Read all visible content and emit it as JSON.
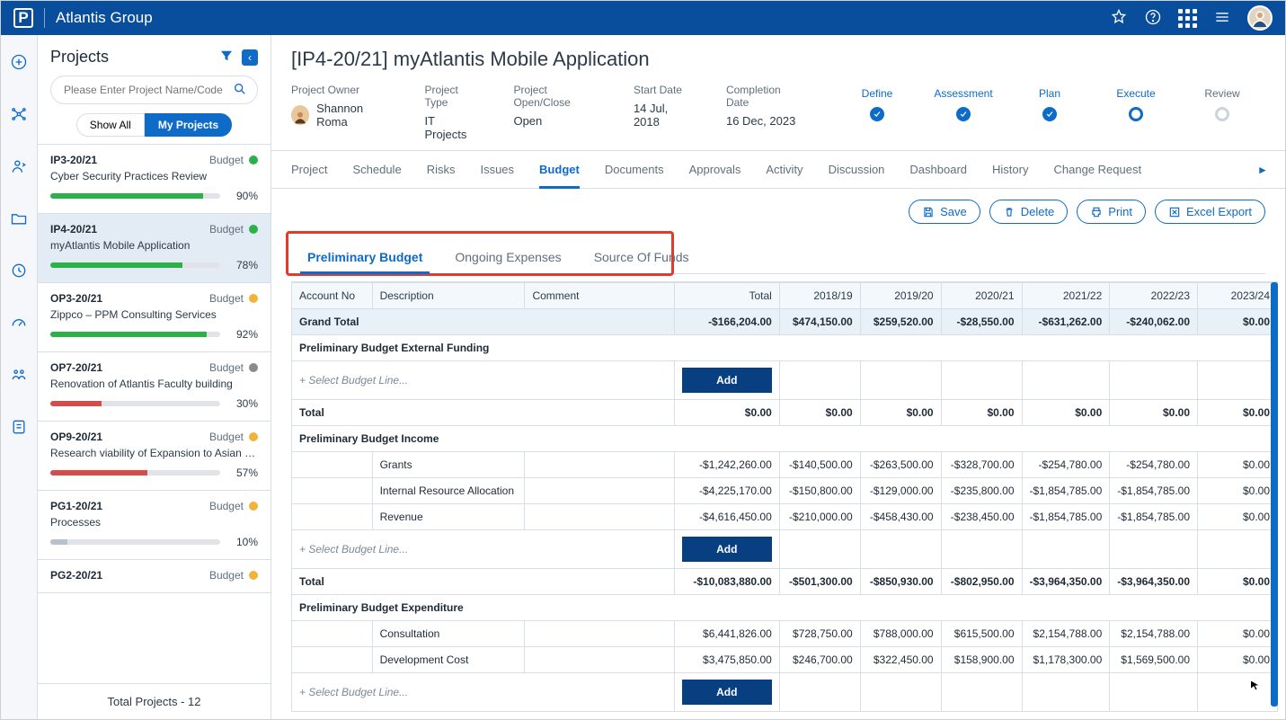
{
  "header": {
    "org_name": "Atlantis Group",
    "logo_letter": "P"
  },
  "projects_panel": {
    "title": "Projects",
    "search_placeholder": "Please Enter Project Name/Code",
    "toggle_all": "Show All",
    "toggle_mine": "My Projects",
    "footer": "Total Projects - 12",
    "budget_label": "Budget",
    "items": [
      {
        "code": "IP3-20/21",
        "name": "Cyber Security Practices Review",
        "pct": "90%",
        "pct_n": 90,
        "dot": "green",
        "bar": "green",
        "active": false
      },
      {
        "code": "IP4-20/21",
        "name": "myAtlantis Mobile Application",
        "pct": "78%",
        "pct_n": 78,
        "dot": "green",
        "bar": "green",
        "active": true
      },
      {
        "code": "OP3-20/21",
        "name": "Zippco – PPM Consulting Services",
        "pct": "92%",
        "pct_n": 92,
        "dot": "amber",
        "bar": "green",
        "active": false
      },
      {
        "code": "OP7-20/21",
        "name": "Renovation of Atlantis Faculty building",
        "pct": "30%",
        "pct_n": 30,
        "dot": "gray",
        "bar": "red",
        "active": false
      },
      {
        "code": "OP9-20/21",
        "name": "Research viability of Expansion to Asian M...",
        "pct": "57%",
        "pct_n": 57,
        "dot": "amber",
        "bar": "red",
        "active": false
      },
      {
        "code": "PG1-20/21",
        "name": "Processes",
        "pct": "10%",
        "pct_n": 10,
        "dot": "amber",
        "bar": "gray",
        "active": false
      },
      {
        "code": "PG2-20/21",
        "name": "",
        "pct": "",
        "pct_n": 0,
        "dot": "amber",
        "bar": "none",
        "active": false
      }
    ]
  },
  "project": {
    "title": "[IP4-20/21] myAtlantis Mobile Application",
    "meta": {
      "owner_label": "Project Owner",
      "owner_value": "Shannon Roma",
      "type_label": "Project Type",
      "type_value": "IT Projects",
      "open_label": "Project Open/Close",
      "open_value": "Open",
      "start_label": "Start Date",
      "start_value": "14 Jul, 2018",
      "complete_label": "Completion Date",
      "complete_value": "16 Dec, 2023"
    },
    "stages": [
      "Define",
      "Assessment",
      "Plan",
      "Execute",
      "Review"
    ]
  },
  "tabs": [
    "Project",
    "Schedule",
    "Risks",
    "Issues",
    "Budget",
    "Documents",
    "Approvals",
    "Activity",
    "Discussion",
    "Dashboard",
    "History",
    "Change Request"
  ],
  "tabs_active": "Budget",
  "actions": {
    "save": "Save",
    "delete": "Delete",
    "print": "Print",
    "export": "Excel Export"
  },
  "subtabs": {
    "active": "Preliminary Budget",
    "items": [
      "Preliminary Budget",
      "Ongoing Expenses",
      "Source Of Funds"
    ]
  },
  "grid": {
    "cols": [
      "Account No",
      "Description",
      "Comment",
      "Total",
      "2018/19",
      "2019/20",
      "2020/21",
      "2021/22",
      "2022/23",
      "2023/24"
    ],
    "grand_label": "Grand Total",
    "grand": [
      "-$166,204.00",
      "$474,150.00",
      "$259,520.00",
      "-$28,550.00",
      "-$631,262.00",
      "-$240,062.00",
      "$0.00"
    ],
    "select_label": "+ Select Budget Line...",
    "add_label": "Add",
    "groups": [
      {
        "title": "Preliminary Budget External Funding",
        "rows": [],
        "total_label": "Total",
        "total": [
          "$0.00",
          "$0.00",
          "$0.00",
          "$0.00",
          "$0.00",
          "$0.00",
          "$0.00"
        ]
      },
      {
        "title": "Preliminary Budget Income",
        "rows": [
          {
            "desc": "Grants",
            "vals": [
              "-$1,242,260.00",
              "-$140,500.00",
              "-$263,500.00",
              "-$328,700.00",
              "-$254,780.00",
              "-$254,780.00",
              "$0.00"
            ]
          },
          {
            "desc": "Internal Resource Allocation",
            "vals": [
              "-$4,225,170.00",
              "-$150,800.00",
              "-$129,000.00",
              "-$235,800.00",
              "-$1,854,785.00",
              "-$1,854,785.00",
              "$0.00"
            ]
          },
          {
            "desc": "Revenue",
            "vals": [
              "-$4,616,450.00",
              "-$210,000.00",
              "-$458,430.00",
              "-$238,450.00",
              "-$1,854,785.00",
              "-$1,854,785.00",
              "$0.00"
            ]
          }
        ],
        "total_label": "Total",
        "total": [
          "-$10,083,880.00",
          "-$501,300.00",
          "-$850,930.00",
          "-$802,950.00",
          "-$3,964,350.00",
          "-$3,964,350.00",
          "$0.00"
        ]
      },
      {
        "title": "Preliminary Budget Expenditure",
        "rows": [
          {
            "desc": "Consultation",
            "vals": [
              "$6,441,826.00",
              "$728,750.00",
              "$788,000.00",
              "$615,500.00",
              "$2,154,788.00",
              "$2,154,788.00",
              "$0.00"
            ]
          },
          {
            "desc": "Development Cost",
            "vals": [
              "$3,475,850.00",
              "$246,700.00",
              "$322,450.00",
              "$158,900.00",
              "$1,178,300.00",
              "$1,569,500.00",
              "$0.00"
            ]
          }
        ],
        "total_label": null,
        "total": null,
        "open_select": true
      }
    ]
  }
}
